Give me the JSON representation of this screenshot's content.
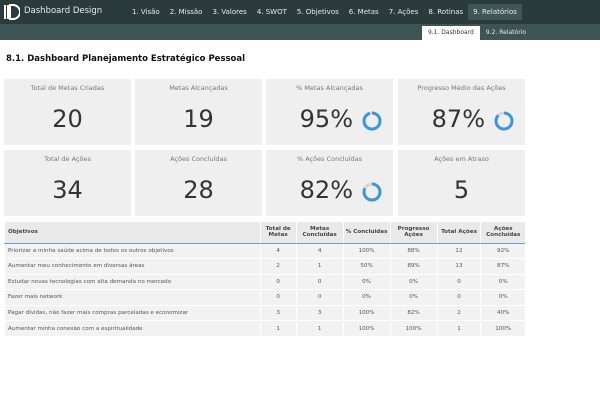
{
  "app": {
    "title": "Dashboard Design"
  },
  "nav": [
    "1. Visão",
    "2. Missão",
    "3. Valores",
    "4. SWOT",
    "5. Objetivos",
    "6. Metas",
    "7. Ações",
    "8. Rotinas",
    "9. Relatórios"
  ],
  "subnav": [
    "9.1. Dashboard",
    "9.2. Relatório"
  ],
  "page_title": "8.1. Dashboard Planejamento Estratégico Pessoal",
  "colors": {
    "accent": "#3b97dd",
    "topbar": "#2b3a3b",
    "subbar": "#3d5455"
  },
  "kpis": [
    {
      "label": "Total de Metas Criadas",
      "value": "20"
    },
    {
      "label": "Metas Alcançadas",
      "value": "19"
    },
    {
      "label": "% Metas Alcançadas",
      "value": "95%",
      "progress": 0.95
    },
    {
      "label": "Progresso Médio das Ações",
      "value": "87%",
      "progress": 0.87
    },
    {
      "label": "Total de Ações",
      "value": "34"
    },
    {
      "label": "Ações Concluídas",
      "value": "28"
    },
    {
      "label": "% Ações Concluídas",
      "value": "82%",
      "progress": 0.82
    },
    {
      "label": "Ações em Atraso",
      "value": "5"
    }
  ],
  "table": {
    "headers": [
      "Objetivos",
      "Total de Metas",
      "Metas Concluídas",
      "% Concluidas",
      "Progresso Ações",
      "Total Ações",
      "Ações Concluídas"
    ],
    "rows": [
      [
        "Priorizar a minha saúde acima de todos os outros objetivos",
        "4",
        "4",
        "100%",
        "88%",
        "12",
        "92%"
      ],
      [
        "Aumentar meu conhecimento em diversas áreas",
        "2",
        "1",
        "50%",
        "89%",
        "13",
        "87%"
      ],
      [
        "Estudar novas tecnologias com alta demanda no mercado",
        "0",
        "0",
        "0%",
        "0%",
        "0",
        "0%"
      ],
      [
        "Fazer mais network",
        "0",
        "0",
        "0%",
        "0%",
        "0",
        "0%"
      ],
      [
        "Pagar dívidas, não fazer mais compras parceladas e economizar",
        "3",
        "3",
        "100%",
        "82%",
        "2",
        "40%"
      ],
      [
        "Aumentar minha conexão com a espiritualidade",
        "1",
        "1",
        "100%",
        "100%",
        "1",
        "100%"
      ]
    ]
  }
}
